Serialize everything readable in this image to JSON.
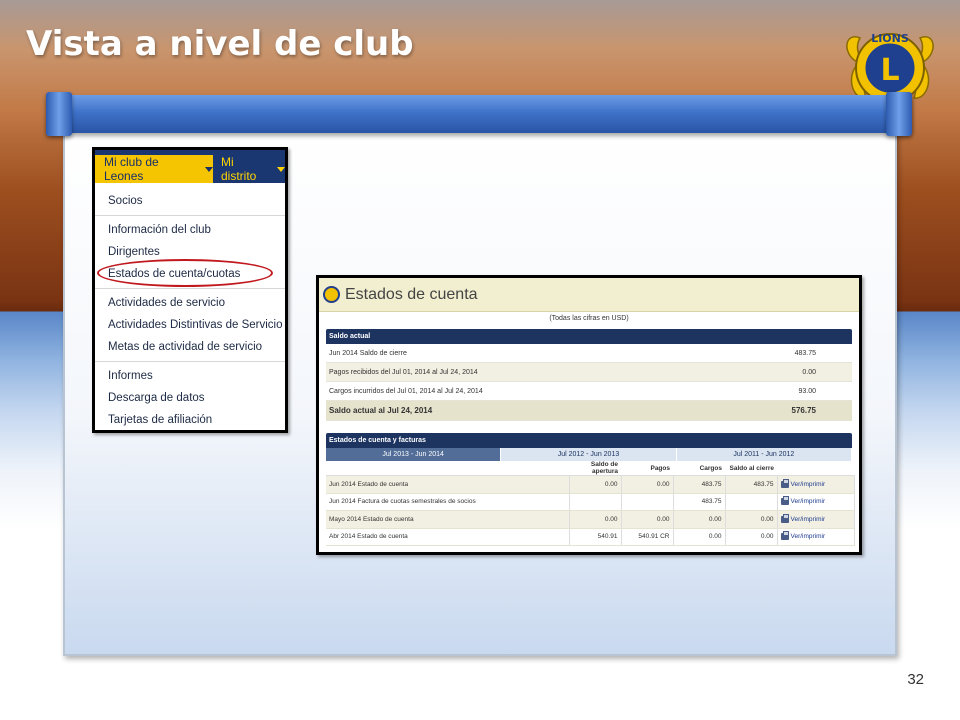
{
  "slide": {
    "title": "Vista a nivel de club",
    "page_number": "32",
    "logo_text": "LIONS"
  },
  "menu": {
    "tab_club": "Mi club de Leones",
    "tab_district": "Mi distrito",
    "items": [
      "Socios",
      "Información del club",
      "Dirigentes",
      "Estados de cuenta/cuotas",
      "Actividades de servicio",
      "Actividades Distintivas de Servicio",
      "Metas de actividad de servicio",
      "Informes",
      "Descarga de datos",
      "Tarjetas de afiliación"
    ]
  },
  "account": {
    "title": "Estados de cuenta",
    "note": "(Todas las cifras en USD)",
    "balance": {
      "header": "Saldo actual",
      "rows": [
        {
          "label": "Jun 2014 Saldo de cierre",
          "value": "483.75"
        },
        {
          "label": "Pagos recibidos del Jul 01, 2014 al Jul 24, 2014",
          "value": "0.00"
        },
        {
          "label": "Cargos incurridos del Jul 01, 2014 al Jul 24, 2014",
          "value": "93.00"
        }
      ],
      "total_label": "Saldo actual al Jul 24, 2014",
      "total_value": "576.75"
    },
    "statements": {
      "header": "Estados de cuenta y facturas",
      "tabs": [
        "Jul 2013 - Jun 2014",
        "Jul 2012 - Jun 2013",
        "Jul 2011 - Jun 2012"
      ],
      "columns": [
        "",
        "Saldo de apertura",
        "Pagos",
        "Cargos",
        "Saldo al cierre",
        ""
      ],
      "rows": [
        {
          "desc": "Jun 2014 Estado de cuenta",
          "opening": "0.00",
          "payments": "0.00",
          "charges": "483.75",
          "closing": "483.75",
          "action": "Ver/imprimir"
        },
        {
          "desc": "Jun 2014 Factura de cuotas semestrales de socios",
          "opening": "",
          "payments": "",
          "charges": "483.75",
          "closing": "",
          "action": "Ver/imprimir"
        },
        {
          "desc": "Mayo 2014 Estado de cuenta",
          "opening": "0.00",
          "payments": "0.00",
          "charges": "0.00",
          "closing": "0.00",
          "action": "Ver/imprimir"
        },
        {
          "desc": "Abr 2014 Estado de cuenta",
          "opening": "540.91",
          "payments": "540.91 CR",
          "charges": "0.00",
          "closing": "0.00",
          "action": "Ver/imprimir"
        }
      ]
    }
  },
  "colors": {
    "menu_bar": "#1a3772",
    "menu_tab_active": "#f4c500",
    "section_header": "#1d3461",
    "highlight_ring": "#c0181d"
  }
}
